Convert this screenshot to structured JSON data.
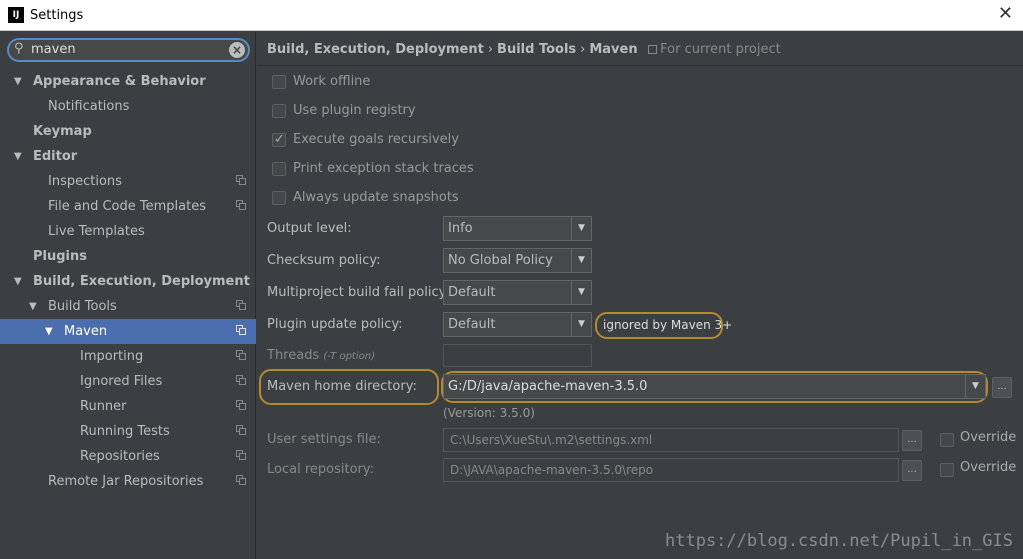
{
  "window": {
    "title": "Settings",
    "app_icon": "IJ"
  },
  "search": {
    "value": "maven"
  },
  "tree": [
    {
      "label": "Appearance & Behavior",
      "indent": 0,
      "arrow": "▼",
      "bold": true,
      "copy": false,
      "selected": false
    },
    {
      "label": "Notifications",
      "indent": 1,
      "arrow": "",
      "bold": false,
      "copy": false,
      "selected": false
    },
    {
      "label": "Keymap",
      "indent": 0,
      "arrow": "",
      "bold": true,
      "copy": false,
      "selected": false
    },
    {
      "label": "Editor",
      "indent": 0,
      "arrow": "▼",
      "bold": true,
      "copy": false,
      "selected": false
    },
    {
      "label": "Inspections",
      "indent": 1,
      "arrow": "",
      "bold": false,
      "copy": true,
      "selected": false
    },
    {
      "label": "File and Code Templates",
      "indent": 1,
      "arrow": "",
      "bold": false,
      "copy": true,
      "selected": false
    },
    {
      "label": "Live Templates",
      "indent": 1,
      "arrow": "",
      "bold": false,
      "copy": false,
      "selected": false
    },
    {
      "label": "Plugins",
      "indent": 0,
      "arrow": "",
      "bold": true,
      "copy": false,
      "selected": false
    },
    {
      "label": "Build, Execution, Deployment",
      "indent": 0,
      "arrow": "▼",
      "bold": true,
      "copy": false,
      "selected": false
    },
    {
      "label": "Build Tools",
      "indent": 1,
      "arrow": "▼",
      "bold": false,
      "copy": true,
      "selected": false
    },
    {
      "label": "Maven",
      "indent": 2,
      "arrow": "▼",
      "bold": false,
      "copy": true,
      "selected": true
    },
    {
      "label": "Importing",
      "indent": 3,
      "arrow": "",
      "bold": false,
      "copy": true,
      "selected": false
    },
    {
      "label": "Ignored Files",
      "indent": 3,
      "arrow": "",
      "bold": false,
      "copy": true,
      "selected": false
    },
    {
      "label": "Runner",
      "indent": 3,
      "arrow": "",
      "bold": false,
      "copy": true,
      "selected": false
    },
    {
      "label": "Running Tests",
      "indent": 3,
      "arrow": "",
      "bold": false,
      "copy": true,
      "selected": false
    },
    {
      "label": "Repositories",
      "indent": 3,
      "arrow": "",
      "bold": false,
      "copy": true,
      "selected": false
    },
    {
      "label": "Remote Jar Repositories",
      "indent": 1,
      "arrow": "",
      "bold": false,
      "copy": true,
      "selected": false
    }
  ],
  "breadcrumb": {
    "part1": "Build, Execution, Deployment",
    "part2": "Build Tools",
    "part3": "Maven",
    "separator": "›",
    "scope": "For current project"
  },
  "checkboxes": {
    "work_offline": {
      "label": "Work offline",
      "checked": false
    },
    "use_plugin_registry": {
      "label": "Use plugin registry",
      "checked": false
    },
    "execute_goals_recursively": {
      "label": "Execute goals recursively",
      "checked": true
    },
    "print_exception_stack_traces": {
      "label": "Print exception stack traces",
      "checked": false
    },
    "always_update_snapshots": {
      "label": "Always update snapshots",
      "checked": false
    }
  },
  "form": {
    "output_level": {
      "label": "Output level:",
      "value": "Info"
    },
    "checksum_policy": {
      "label": "Checksum policy:",
      "value": "No Global Policy"
    },
    "multiproject_fail_policy": {
      "label": "Multiproject build fail policy:",
      "value": "Default"
    },
    "plugin_update_policy": {
      "label": "Plugin update policy:",
      "value": "Default",
      "note": "ignored by Maven 3+"
    },
    "threads": {
      "label": "Threads",
      "hint": "(-T option)",
      "value": ""
    },
    "maven_home": {
      "label": "Maven home directory:",
      "value": "G:/D/java/apache-maven-3.5.0",
      "version": "(Version: 3.5.0)"
    },
    "user_settings": {
      "label": "User settings file:",
      "value": "C:\\Users\\XueStu\\.m2\\settings.xml",
      "override_label": "Override"
    },
    "local_repository": {
      "label": "Local repository:",
      "value": "D:\\JAVA\\apache-maven-3.5.0\\repo",
      "override_label": "Override"
    },
    "browse_label": "..."
  },
  "watermark": "https://blog.csdn.net/Pupil_in_GIS",
  "colors": {
    "selection": "#4b6eaf",
    "highlight_ring": "#b58a2f",
    "search_focus": "#5a8ac6"
  }
}
